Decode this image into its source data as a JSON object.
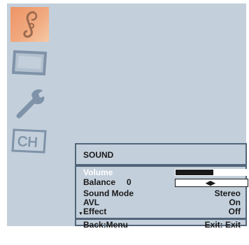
{
  "side_menu": [
    {
      "name": "sound-note-icon"
    },
    {
      "name": "picture-tv-icon"
    },
    {
      "name": "setup-wrench-icon"
    },
    {
      "name": "channel-ch-icon",
      "text": "CH"
    }
  ],
  "panel": {
    "title": "SOUND",
    "items": [
      {
        "label": "Volume",
        "level": 0.52
      },
      {
        "label": "Balance",
        "value": "0"
      },
      {
        "label": "Sound Mode",
        "value": "Stereo"
      },
      {
        "label": "AVL",
        "value": "On"
      },
      {
        "label": "Effect",
        "value": "Off"
      }
    ],
    "footer": {
      "back": "Back:Menu",
      "exit": "Exit: Exit"
    }
  },
  "colors": {
    "background": "#c3cfdb",
    "frame": "#52657a",
    "selected_icon": "#ee9466"
  }
}
